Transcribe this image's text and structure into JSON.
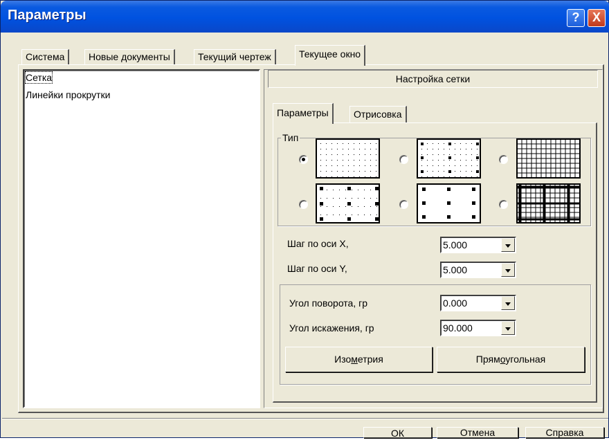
{
  "window": {
    "title": "Параметры",
    "help_label": "?",
    "close_label": "X"
  },
  "tabs": [
    "Система",
    "Новые документы",
    "Текущий чертеж",
    "Текущее окно"
  ],
  "tree": {
    "items": [
      "Сетка",
      "Линейки прокрутки"
    ],
    "selected": 0
  },
  "panel": {
    "header": "Настройка сетки",
    "subtabs": [
      "Параметры",
      "Отрисовка"
    ],
    "type_group_label": "Тип",
    "grid_types_selected": 0,
    "step_x_label": "Шаг по оси X,",
    "step_x_value": "5.000",
    "step_y_label": "Шаг по оси Y,",
    "step_y_value": "5.000",
    "angle_rot_label": "Угол поворота, гр",
    "angle_rot_value": "0.000",
    "angle_skew_label": "Угол искажения, гр",
    "angle_skew_value": "90.000",
    "iso_pre": "Изо",
    "iso_u": "м",
    "iso_post": "етрия",
    "rect_pre": "Прям",
    "rect_u": "о",
    "rect_post": "угольная"
  },
  "buttons": {
    "ok": "ОК",
    "cancel": "Отмена",
    "help": "Справка"
  }
}
